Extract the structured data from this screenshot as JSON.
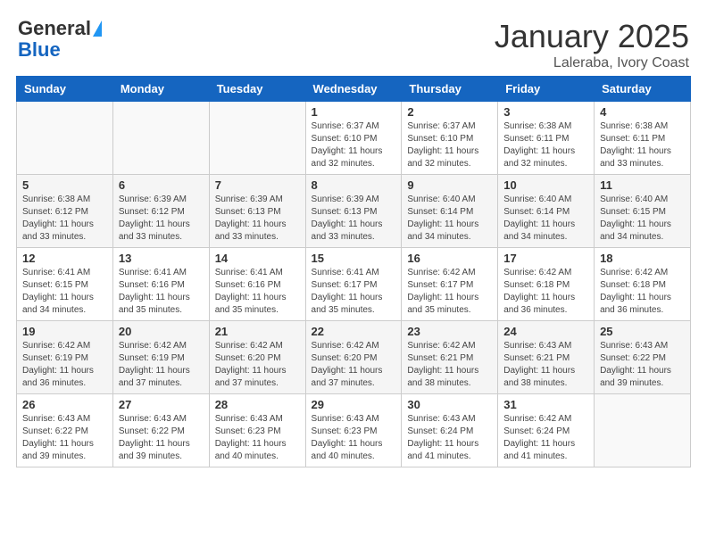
{
  "header": {
    "logo_general": "General",
    "logo_blue": "Blue",
    "month_title": "January 2025",
    "location": "Laleraba, Ivory Coast"
  },
  "weekdays": [
    "Sunday",
    "Monday",
    "Tuesday",
    "Wednesday",
    "Thursday",
    "Friday",
    "Saturday"
  ],
  "weeks": [
    [
      {
        "day": "",
        "info": ""
      },
      {
        "day": "",
        "info": ""
      },
      {
        "day": "",
        "info": ""
      },
      {
        "day": "1",
        "info": "Sunrise: 6:37 AM\nSunset: 6:10 PM\nDaylight: 11 hours\nand 32 minutes."
      },
      {
        "day": "2",
        "info": "Sunrise: 6:37 AM\nSunset: 6:10 PM\nDaylight: 11 hours\nand 32 minutes."
      },
      {
        "day": "3",
        "info": "Sunrise: 6:38 AM\nSunset: 6:11 PM\nDaylight: 11 hours\nand 32 minutes."
      },
      {
        "day": "4",
        "info": "Sunrise: 6:38 AM\nSunset: 6:11 PM\nDaylight: 11 hours\nand 33 minutes."
      }
    ],
    [
      {
        "day": "5",
        "info": "Sunrise: 6:38 AM\nSunset: 6:12 PM\nDaylight: 11 hours\nand 33 minutes."
      },
      {
        "day": "6",
        "info": "Sunrise: 6:39 AM\nSunset: 6:12 PM\nDaylight: 11 hours\nand 33 minutes."
      },
      {
        "day": "7",
        "info": "Sunrise: 6:39 AM\nSunset: 6:13 PM\nDaylight: 11 hours\nand 33 minutes."
      },
      {
        "day": "8",
        "info": "Sunrise: 6:39 AM\nSunset: 6:13 PM\nDaylight: 11 hours\nand 33 minutes."
      },
      {
        "day": "9",
        "info": "Sunrise: 6:40 AM\nSunset: 6:14 PM\nDaylight: 11 hours\nand 34 minutes."
      },
      {
        "day": "10",
        "info": "Sunrise: 6:40 AM\nSunset: 6:14 PM\nDaylight: 11 hours\nand 34 minutes."
      },
      {
        "day": "11",
        "info": "Sunrise: 6:40 AM\nSunset: 6:15 PM\nDaylight: 11 hours\nand 34 minutes."
      }
    ],
    [
      {
        "day": "12",
        "info": "Sunrise: 6:41 AM\nSunset: 6:15 PM\nDaylight: 11 hours\nand 34 minutes."
      },
      {
        "day": "13",
        "info": "Sunrise: 6:41 AM\nSunset: 6:16 PM\nDaylight: 11 hours\nand 35 minutes."
      },
      {
        "day": "14",
        "info": "Sunrise: 6:41 AM\nSunset: 6:16 PM\nDaylight: 11 hours\nand 35 minutes."
      },
      {
        "day": "15",
        "info": "Sunrise: 6:41 AM\nSunset: 6:17 PM\nDaylight: 11 hours\nand 35 minutes."
      },
      {
        "day": "16",
        "info": "Sunrise: 6:42 AM\nSunset: 6:17 PM\nDaylight: 11 hours\nand 35 minutes."
      },
      {
        "day": "17",
        "info": "Sunrise: 6:42 AM\nSunset: 6:18 PM\nDaylight: 11 hours\nand 36 minutes."
      },
      {
        "day": "18",
        "info": "Sunrise: 6:42 AM\nSunset: 6:18 PM\nDaylight: 11 hours\nand 36 minutes."
      }
    ],
    [
      {
        "day": "19",
        "info": "Sunrise: 6:42 AM\nSunset: 6:19 PM\nDaylight: 11 hours\nand 36 minutes."
      },
      {
        "day": "20",
        "info": "Sunrise: 6:42 AM\nSunset: 6:19 PM\nDaylight: 11 hours\nand 37 minutes."
      },
      {
        "day": "21",
        "info": "Sunrise: 6:42 AM\nSunset: 6:20 PM\nDaylight: 11 hours\nand 37 minutes."
      },
      {
        "day": "22",
        "info": "Sunrise: 6:42 AM\nSunset: 6:20 PM\nDaylight: 11 hours\nand 37 minutes."
      },
      {
        "day": "23",
        "info": "Sunrise: 6:42 AM\nSunset: 6:21 PM\nDaylight: 11 hours\nand 38 minutes."
      },
      {
        "day": "24",
        "info": "Sunrise: 6:43 AM\nSunset: 6:21 PM\nDaylight: 11 hours\nand 38 minutes."
      },
      {
        "day": "25",
        "info": "Sunrise: 6:43 AM\nSunset: 6:22 PM\nDaylight: 11 hours\nand 39 minutes."
      }
    ],
    [
      {
        "day": "26",
        "info": "Sunrise: 6:43 AM\nSunset: 6:22 PM\nDaylight: 11 hours\nand 39 minutes."
      },
      {
        "day": "27",
        "info": "Sunrise: 6:43 AM\nSunset: 6:22 PM\nDaylight: 11 hours\nand 39 minutes."
      },
      {
        "day": "28",
        "info": "Sunrise: 6:43 AM\nSunset: 6:23 PM\nDaylight: 11 hours\nand 40 minutes."
      },
      {
        "day": "29",
        "info": "Sunrise: 6:43 AM\nSunset: 6:23 PM\nDaylight: 11 hours\nand 40 minutes."
      },
      {
        "day": "30",
        "info": "Sunrise: 6:43 AM\nSunset: 6:24 PM\nDaylight: 11 hours\nand 41 minutes."
      },
      {
        "day": "31",
        "info": "Sunrise: 6:42 AM\nSunset: 6:24 PM\nDaylight: 11 hours\nand 41 minutes."
      },
      {
        "day": "",
        "info": ""
      }
    ]
  ]
}
